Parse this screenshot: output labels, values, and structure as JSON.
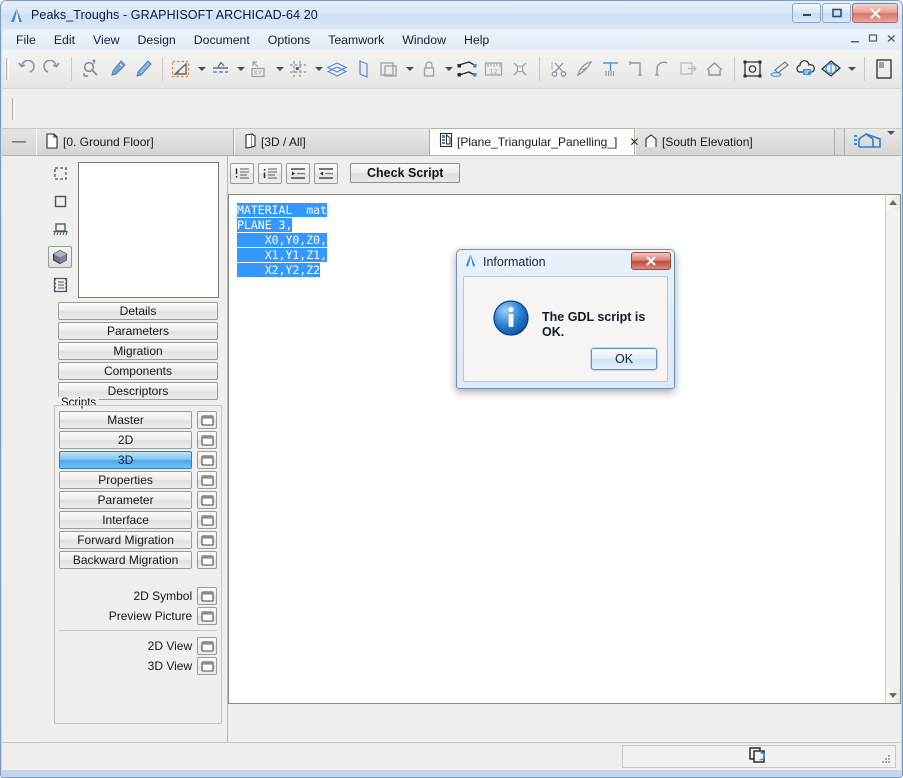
{
  "window": {
    "title": "Peaks_Troughs - GRAPHISOFT ARCHICAD-64 20",
    "app_icon": "archicad-logo-icon",
    "minimize_label": "–",
    "maximize_label": "❐",
    "close_label": "✕"
  },
  "menu": {
    "items": [
      {
        "label": "File"
      },
      {
        "label": "Edit"
      },
      {
        "label": "View"
      },
      {
        "label": "Design"
      },
      {
        "label": "Document"
      },
      {
        "label": "Options"
      },
      {
        "label": "Teamwork"
      },
      {
        "label": "Window"
      },
      {
        "label": "Help"
      }
    ],
    "mdi": {
      "minimize": "–",
      "restore": "❐",
      "close": "✕"
    }
  },
  "toolbar": {
    "groups": [
      {
        "icons": [
          "undo-icon",
          "redo-icon"
        ]
      },
      {
        "icons": [
          "marquee-zoom-icon",
          "eyedropper-icon",
          "syringe-injector-icon"
        ]
      },
      {
        "icons": [
          "angle-measure-icon",
          "elevation-dimension-icon",
          "coordinate-xy-icon",
          "grid-snap-icon",
          "layers-icon",
          "wall-face-icon",
          "copy-layers-icon",
          "padlock-icon"
        ]
      },
      {
        "icons": [
          "drag-copy-icon",
          "measure-tape-icon",
          "stretch-icon"
        ]
      },
      {
        "icons": [
          "scissors-icon",
          "magic-wand-icon",
          "align-top-icon",
          "offset-corner-icon",
          "fillet-arc-icon",
          "adjust-icon",
          "roof-home-icon"
        ]
      },
      {
        "icons": [
          "group-selection-icon",
          "paintbrush-icon",
          "cloud-tag-icon",
          "rotate-3d-icon"
        ]
      },
      {
        "icons": [
          "panel-dock-icon"
        ]
      }
    ]
  },
  "tabs": {
    "collapse_icon": "collapse-dash-icon",
    "items": [
      {
        "label": "[0. Ground Floor]",
        "icon": "floor-plan-icon",
        "active": false,
        "closable": false
      },
      {
        "label": "[3D / All]",
        "icon": "three-d-view-icon",
        "active": false,
        "closable": false
      },
      {
        "label": "[Plane_Triangular_Panelling_]",
        "icon": "gdl-object-icon",
        "active": true,
        "closable": true,
        "close_label": "✕"
      },
      {
        "label": "[South Elevation]",
        "icon": "elevation-icon",
        "active": false,
        "closable": false
      }
    ],
    "right_tool": {
      "icon": "navigator-house-icon",
      "caret": true
    }
  },
  "sidebar": {
    "icon_strip": [
      {
        "name": "selection-dashed-icon",
        "selected": false
      },
      {
        "name": "square-outline-icon",
        "selected": false
      },
      {
        "name": "floor-pedestal-icon",
        "selected": false
      },
      {
        "name": "three-d-cube-icon",
        "selected": true
      },
      {
        "name": "list-film-icon",
        "selected": false
      }
    ],
    "preview": {
      "name": "preview-thumbnail",
      "content": ""
    },
    "panel_buttons": [
      {
        "label": "Details"
      },
      {
        "label": "Parameters"
      },
      {
        "label": "Migration"
      },
      {
        "label": "Components"
      },
      {
        "label": "Descriptors"
      }
    ],
    "scripts_group_label": "Scripts",
    "scripts": [
      {
        "label": "Master",
        "selected": false,
        "window_icon": "open-window-icon"
      },
      {
        "label": "2D",
        "selected": false,
        "window_icon": "open-window-icon"
      },
      {
        "label": "3D",
        "selected": true,
        "window_icon": "open-window-icon"
      },
      {
        "label": "Properties",
        "selected": false,
        "window_icon": "open-window-icon"
      },
      {
        "label": "Parameter",
        "selected": false,
        "window_icon": "open-window-icon"
      },
      {
        "label": "Interface",
        "selected": false,
        "window_icon": "open-window-icon"
      },
      {
        "label": "Forward Migration",
        "selected": false,
        "window_icon": "open-window-icon"
      },
      {
        "label": "Backward Migration",
        "selected": false,
        "window_icon": "open-window-icon"
      }
    ],
    "extras_group_a": [
      {
        "label": "2D Symbol",
        "window_icon": "open-window-icon"
      },
      {
        "label": "Preview Picture",
        "window_icon": "open-window-icon"
      }
    ],
    "extras_group_b": [
      {
        "label": "2D View",
        "window_icon": "open-window-icon"
      },
      {
        "label": "3D View",
        "window_icon": "open-window-icon"
      }
    ]
  },
  "editor": {
    "format_buttons": [
      {
        "name": "uppercase-keywords-button",
        "icon": "exclaim-lines-icon"
      },
      {
        "name": "lowercase-keywords-button",
        "icon": "lines-icon"
      },
      {
        "name": "indent-button",
        "icon": "indent-right-icon"
      },
      {
        "name": "outdent-button",
        "icon": "indent-left-icon"
      }
    ],
    "check_script_label": "Check Script",
    "code_lines": [
      {
        "text": "MATERIAL  mat",
        "selected": true
      },
      {
        "text": "PLANE 3,",
        "selected": true
      },
      {
        "text": "    X0,Y0,Z0,",
        "selected": true
      },
      {
        "text": "    X1,Y1,Z1,",
        "selected": true
      },
      {
        "text": "    X2,Y2,Z2",
        "selected": true
      }
    ],
    "code_text": "MATERIAL  mat\nPLANE 3,\n    X0,Y0,Z0,\n    X1,Y1,Z1,\n    X2,Y2,Z2",
    "scrollbar": {
      "up_arrow": "▲",
      "down_arrow": "▼"
    }
  },
  "status_bar": {
    "icon": "sync-copy-icon",
    "resize_grip": "resize-grip-icon"
  },
  "dialog": {
    "title": "Information",
    "title_icon": "archicad-logo-icon",
    "close_label": "✕",
    "icon": "info-circle-icon",
    "message": "The GDL script is OK.",
    "ok_label": "OK"
  },
  "colors": {
    "accent_blue": "#2f7ed8",
    "selection_blue": "#3399ff",
    "frame_blue": "#7b9dc4",
    "close_red": "#c0493c"
  }
}
